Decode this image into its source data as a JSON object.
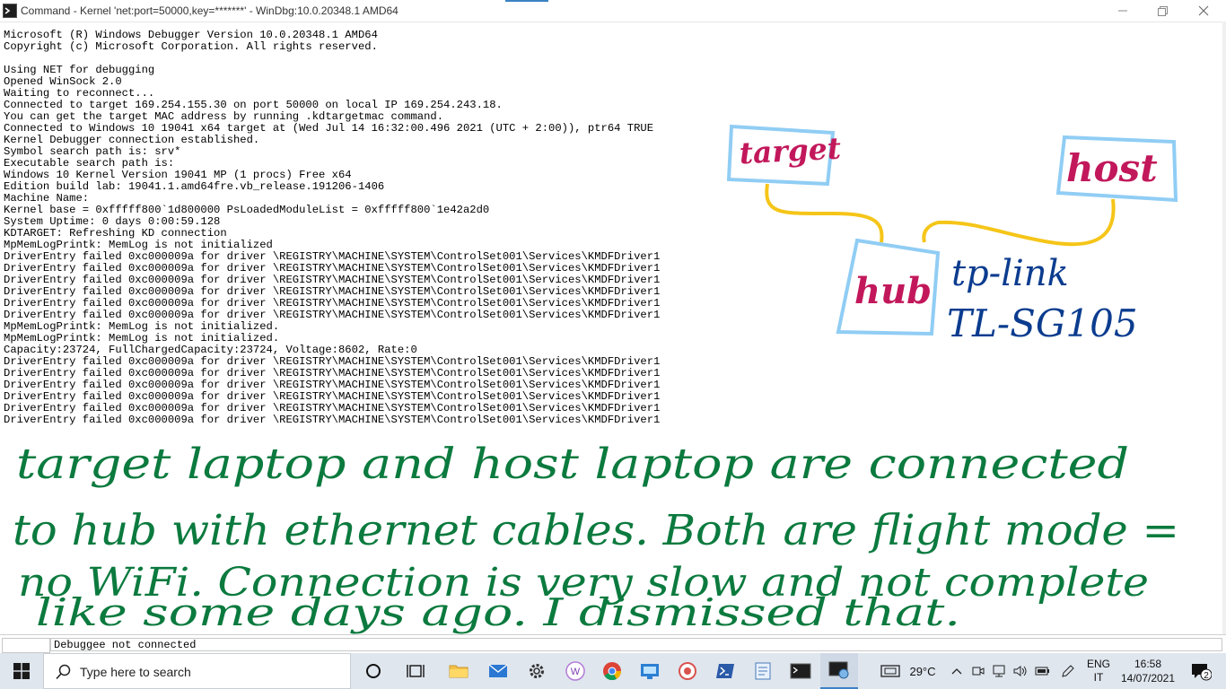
{
  "window": {
    "title": "Command - Kernel 'net:port=50000,key=*******' - WinDbg:10.0.20348.1 AMD64"
  },
  "console": {
    "lines": [
      "Microsoft (R) Windows Debugger Version 10.0.20348.1 AMD64",
      "Copyright (c) Microsoft Corporation. All rights reserved.",
      "",
      "Using NET for debugging",
      "Opened WinSock 2.0",
      "Waiting to reconnect...",
      "Connected to target 169.254.155.30 on port 50000 on local IP 169.254.243.18.",
      "You can get the target MAC address by running .kdtargetmac command.",
      "Connected to Windows 10 19041 x64 target at (Wed Jul 14 16:32:00.496 2021 (UTC + 2:00)), ptr64 TRUE",
      "Kernel Debugger connection established.",
      "Symbol search path is: srv*",
      "Executable search path is:",
      "Windows 10 Kernel Version 19041 MP (1 procs) Free x64",
      "Edition build lab: 19041.1.amd64fre.vb_release.191206-1406",
      "Machine Name:",
      "Kernel base = 0xfffff800`1d800000 PsLoadedModuleList = 0xfffff800`1e42a2d0",
      "System Uptime: 0 days 0:00:59.128",
      "KDTARGET: Refreshing KD connection",
      "MpMemLogPrintk: MemLog is not initialized",
      "DriverEntry failed 0xc000009a for driver \\REGISTRY\\MACHINE\\SYSTEM\\ControlSet001\\Services\\KMDFDriver1",
      "DriverEntry failed 0xc000009a for driver \\REGISTRY\\MACHINE\\SYSTEM\\ControlSet001\\Services\\KMDFDriver1",
      "DriverEntry failed 0xc000009a for driver \\REGISTRY\\MACHINE\\SYSTEM\\ControlSet001\\Services\\KMDFDriver1",
      "DriverEntry failed 0xc000009a for driver \\REGISTRY\\MACHINE\\SYSTEM\\ControlSet001\\Services\\KMDFDriver1",
      "DriverEntry failed 0xc000009a for driver \\REGISTRY\\MACHINE\\SYSTEM\\ControlSet001\\Services\\KMDFDriver1",
      "DriverEntry failed 0xc000009a for driver \\REGISTRY\\MACHINE\\SYSTEM\\ControlSet001\\Services\\KMDFDriver1",
      "MpMemLogPrintk: MemLog is not initialized.",
      "MpMemLogPrintk: MemLog is not initialized.",
      "Capacity:23724, FullChargedCapacity:23724, Voltage:8602, Rate:0",
      "DriverEntry failed 0xc000009a for driver \\REGISTRY\\MACHINE\\SYSTEM\\ControlSet001\\Services\\KMDFDriver1",
      "DriverEntry failed 0xc000009a for driver \\REGISTRY\\MACHINE\\SYSTEM\\ControlSet001\\Services\\KMDFDriver1",
      "DriverEntry failed 0xc000009a for driver \\REGISTRY\\MACHINE\\SYSTEM\\ControlSet001\\Services\\KMDFDriver1",
      "DriverEntry failed 0xc000009a for driver \\REGISTRY\\MACHINE\\SYSTEM\\ControlSet001\\Services\\KMDFDriver1",
      "DriverEntry failed 0xc000009a for driver \\REGISTRY\\MACHINE\\SYSTEM\\ControlSet001\\Services\\KMDFDriver1",
      "DriverEntry failed 0xc000009a for driver \\REGISTRY\\MACHINE\\SYSTEM\\ControlSet001\\Services\\KMDFDriver1"
    ]
  },
  "command_bar": {
    "prompt": "",
    "status_text": "Debuggee not connected"
  },
  "annotations": {
    "target_label": "target",
    "host_label": "host",
    "hub_label": "hub",
    "device_line1": "tp-link",
    "device_line2": "TL-SG105",
    "note_lines": [
      "target laptop  and  host laptop  are  connected",
      "to hub with ethernet cables. Both are flight mode =",
      "no WiFi. Connection is very slow and not complete",
      "like some days ago. I dismissed that."
    ],
    "colors": {
      "pink": "#c2185b",
      "box_blue": "#90cdf4",
      "cable_yellow": "#f5c518",
      "note_green": "#0b7a3e"
    }
  },
  "taskbar": {
    "search_placeholder": "Type here to search",
    "temperature": "29°C",
    "language_line1": "ENG",
    "language_line2": "IT",
    "time": "16:58",
    "date": "14/07/2021",
    "notification_count": "2",
    "pinned_icons": [
      "cortana-circle-icon",
      "task-view-icon",
      "file-explorer-icon",
      "mail-icon",
      "settings-icon",
      "office-w-icon",
      "chrome-icon",
      "remote-desktop-icon",
      "windbg-icon",
      "powershell-icon",
      "notepad-icon",
      "terminal-icon",
      "windbg-active-icon"
    ]
  }
}
